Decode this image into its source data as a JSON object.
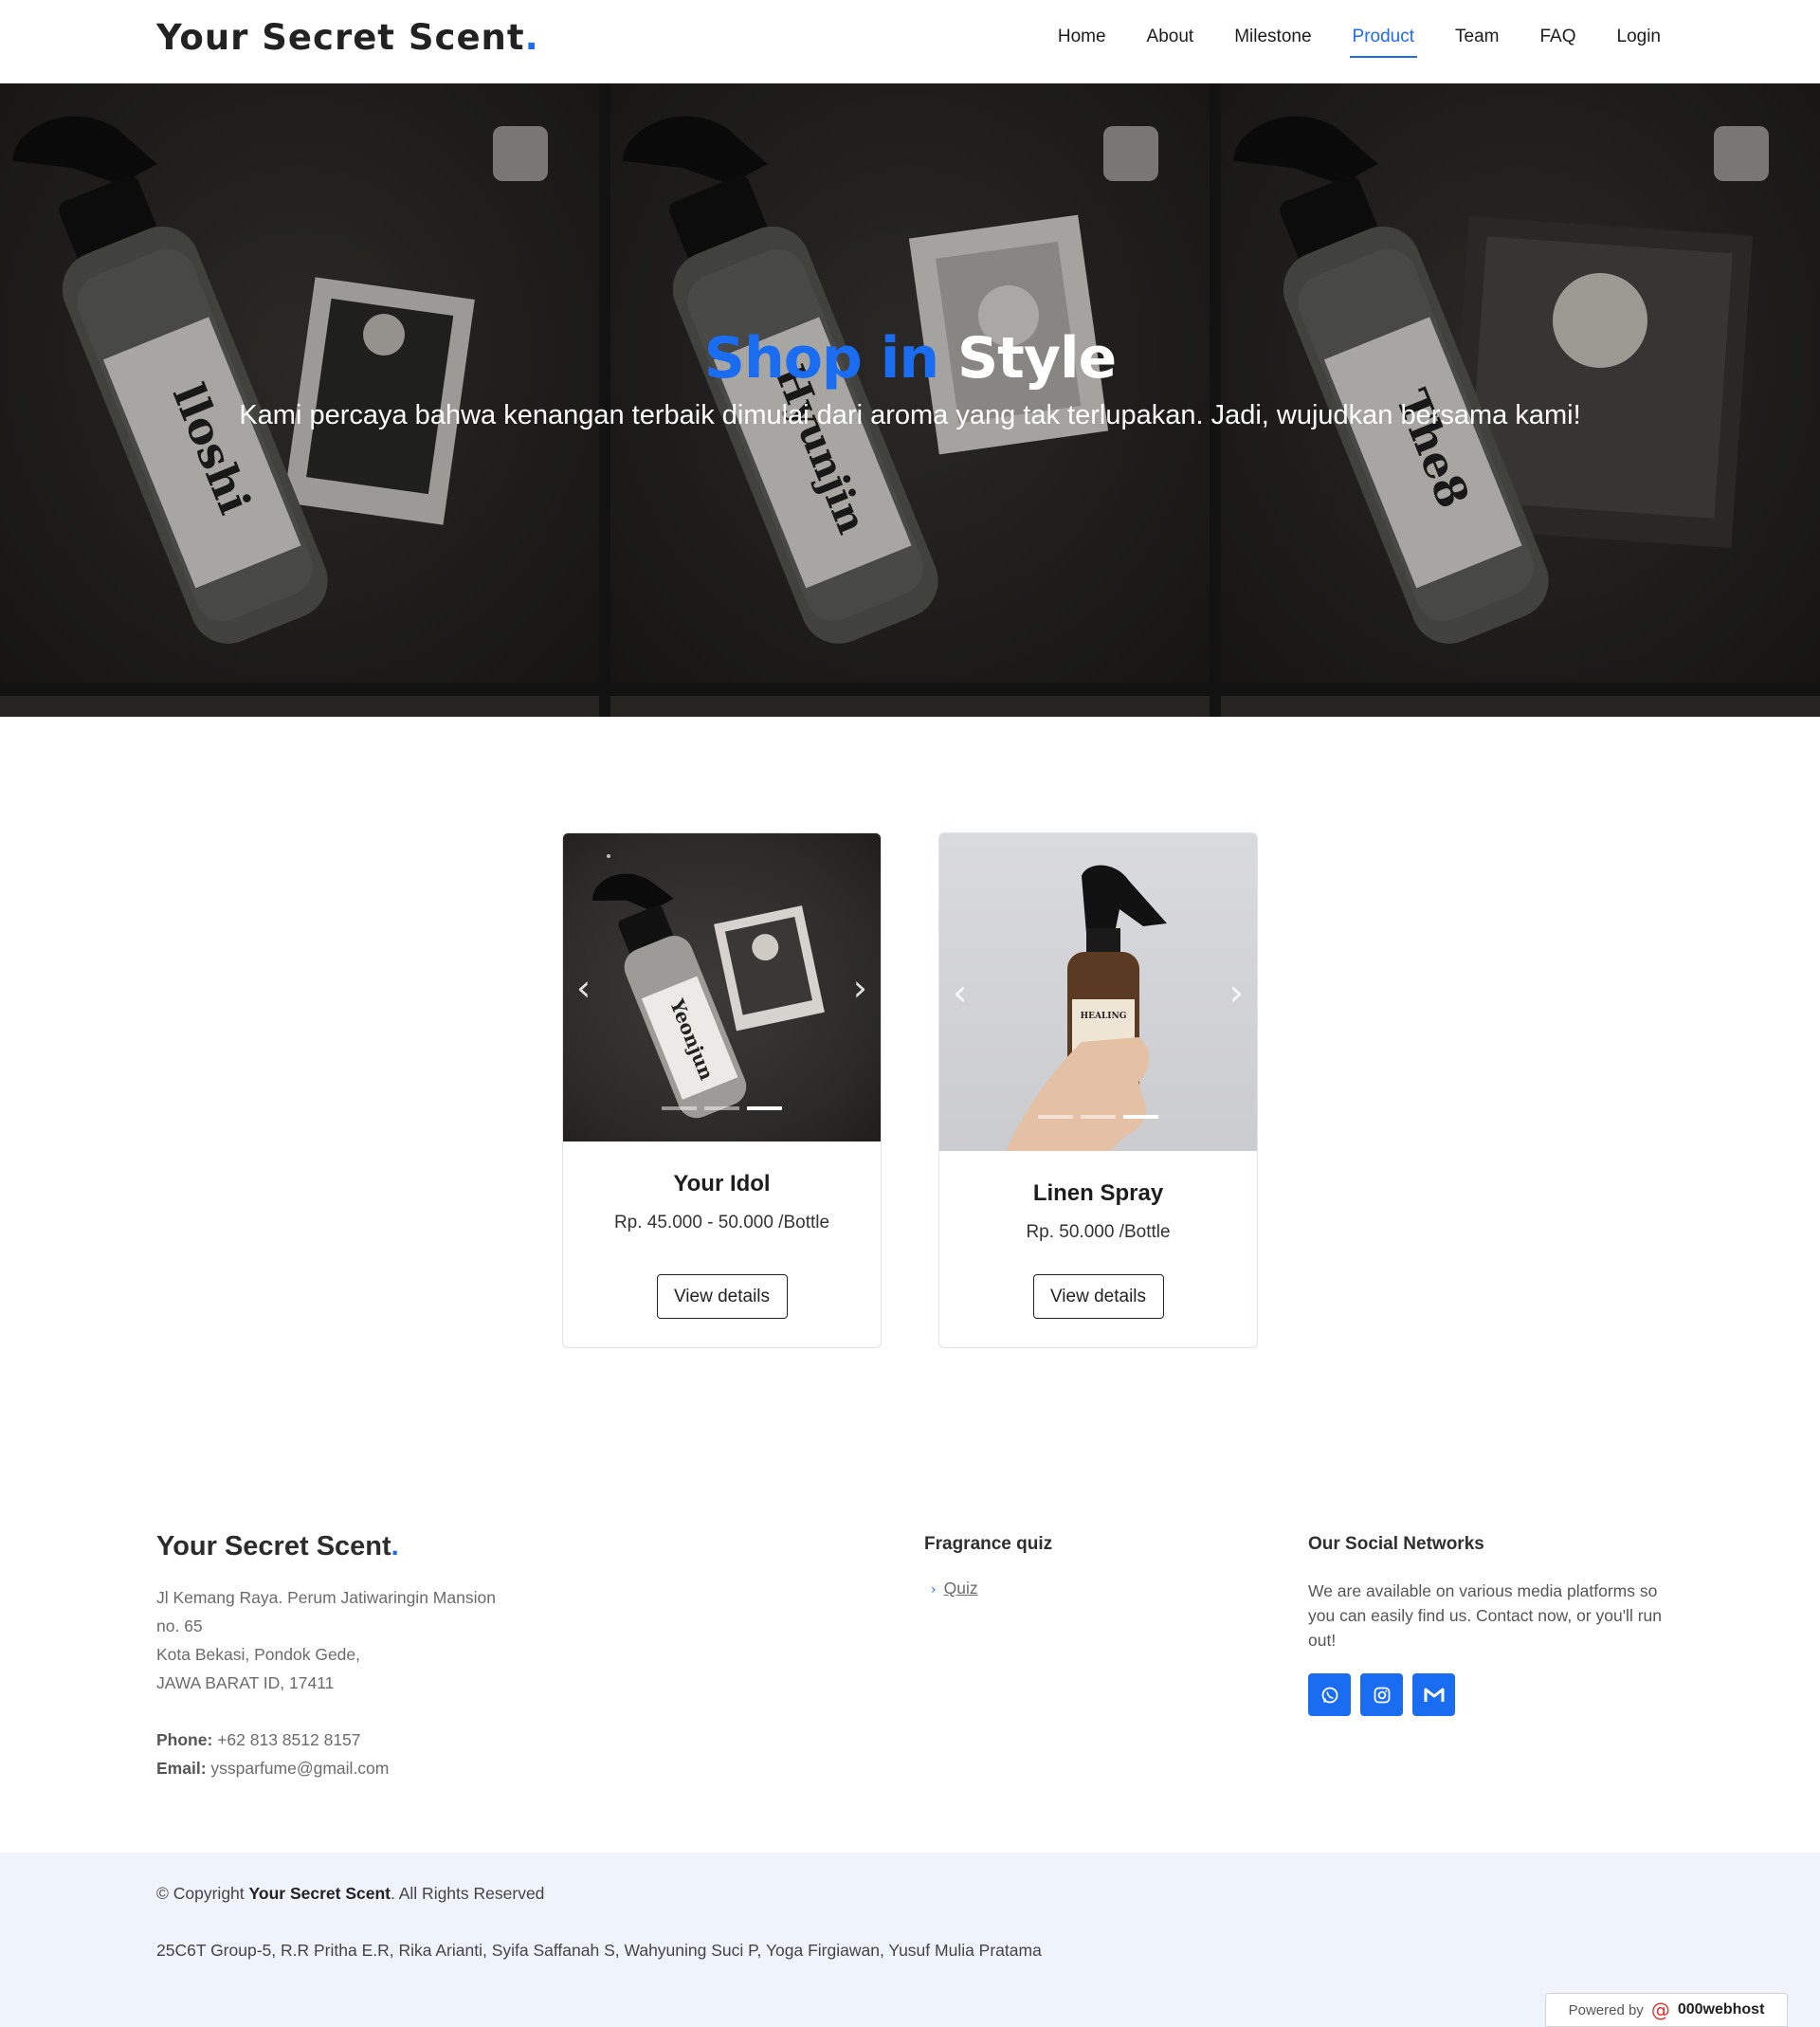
{
  "header": {
    "logo_text": "Your Secret Scent",
    "logo_dot": ".",
    "nav": [
      "Home",
      "About",
      "Milestone",
      "Product",
      "Team",
      "FAQ",
      "Login"
    ],
    "active_nav": "Product"
  },
  "hero": {
    "title_blue": "Shop in",
    "title_white": "Style",
    "subtitle": "Kami percaya bahwa kenangan terbaik dimulai dari aroma yang tak terlupakan. Jadi, wujudkan bersama kami!",
    "tile_labels": [
      "lloshi",
      "Hyunjin",
      "The8"
    ]
  },
  "products": [
    {
      "name": "Your Idol",
      "price": "Rp. 45.000 - 50.000 /Bottle",
      "button": "View details",
      "label_on_bottle": "Yeonjun",
      "slides": 3,
      "active_slide": 3
    },
    {
      "name": "Linen Spray",
      "price": "Rp. 50.000 /Bottle",
      "button": "View details",
      "label_on_bottle": "HEALING",
      "slides": 3,
      "active_slide": 3
    }
  ],
  "footer": {
    "logo_text": "Your Secret Scent",
    "logo_dot": ".",
    "address": [
      "Jl Kemang Raya. Perum Jatiwaringin Mansion",
      "no. 65",
      "Kota Bekasi, Pondok Gede,",
      "JAWA BARAT ID, 17411"
    ],
    "phone_label": "Phone:",
    "phone": "+62 813 8512 8157",
    "email_label": "Email:",
    "email": "yssparfume@gmail.com",
    "quiz_heading": "Fragrance quiz",
    "quiz_link": "Quiz",
    "social_heading": "Our Social Networks",
    "social_text": "We are available on various media platforms so you can easily find us. Contact now, or you'll run out!",
    "social_icons": [
      "whatsapp-icon",
      "instagram-icon",
      "gmail-icon"
    ],
    "accent_color": "#1a6cf0"
  },
  "bottom": {
    "copyright_prefix": "© Copyright",
    "copyright_brand": "Your Secret Scent",
    "copyright_suffix": ". All Rights Reserved",
    "credits": "25C6T Group-5, R.R Pritha E.R, Rika Arianti, Syifa Saffanah S, Wahyuning Suci P, Yoga Firgiawan, Yusuf Mulia Pratama",
    "powered_by": "Powered by",
    "host_brand": "000webhost"
  }
}
